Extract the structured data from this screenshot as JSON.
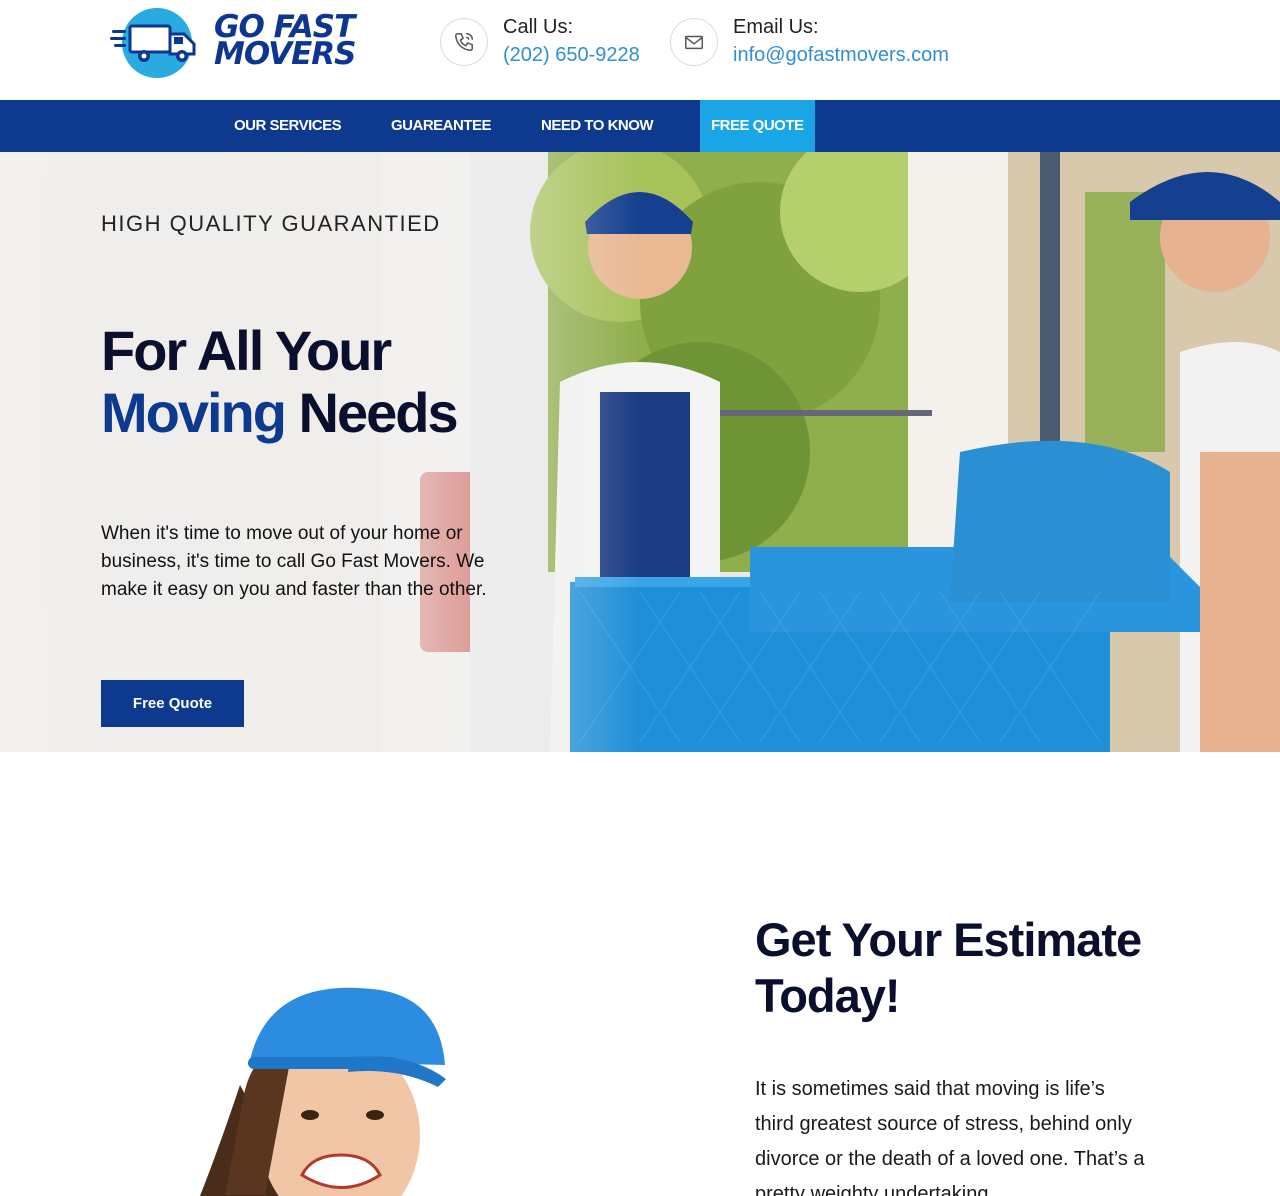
{
  "header": {
    "logo": {
      "line1": "GO FAST",
      "line2": "MOVERS"
    },
    "call": {
      "label": "Call Us:",
      "value": "(202) 650-9228"
    },
    "email": {
      "label": "Email Us:",
      "value": "info@gofastmovers.com"
    }
  },
  "nav": {
    "items": [
      {
        "label": "OUR SERVICES"
      },
      {
        "label": "GUAREANTEE"
      },
      {
        "label": "NEED TO KNOW"
      },
      {
        "label": "FREE QUOTE",
        "active": true
      }
    ]
  },
  "hero": {
    "kicker": "HIGH QUALITY GUARANTIED",
    "title_line1": "For All Your",
    "title_accent": "Moving",
    "title_rest": "Needs",
    "text": "When it's time to move out of your home or business, it's time to call Go Fast Movers. We make it easy on you and faster than the other.",
    "button_label": "Free Quote"
  },
  "estimate": {
    "title_line1": "Get Your Estimate",
    "title_line2": "Today!",
    "text": "It is sometimes said that moving is life’s third greatest source of stress, behind only divorce or the death of a loved one. That’s a pretty weighty undertaking"
  },
  "colors": {
    "brand_navy": "#0d3a8e",
    "accent_sky": "#1aa6e6",
    "link_blue": "#2f8fd3"
  }
}
